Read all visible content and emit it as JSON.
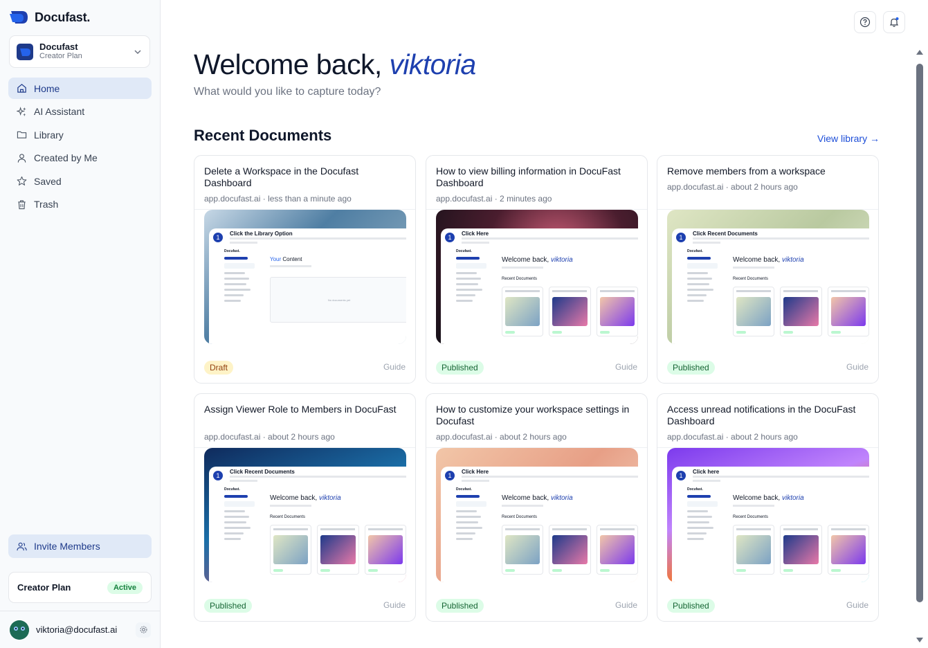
{
  "app": {
    "logo_text": "Docufast.",
    "brand_color": "#1e40af"
  },
  "workspace": {
    "name": "Docufast",
    "plan": "Creator Plan"
  },
  "nav": [
    {
      "label": "Home",
      "icon": "home-icon",
      "active": true
    },
    {
      "label": "AI Assistant",
      "icon": "sparkle-icon",
      "active": false
    },
    {
      "label": "Library",
      "icon": "folder-icon",
      "active": false
    },
    {
      "label": "Created by Me",
      "icon": "user-icon",
      "active": false
    },
    {
      "label": "Saved",
      "icon": "star-icon",
      "active": false
    },
    {
      "label": "Trash",
      "icon": "trash-icon",
      "active": false
    }
  ],
  "invite": {
    "label": "Invite Members"
  },
  "plan_card": {
    "name": "Creator Plan",
    "status": "Active"
  },
  "user": {
    "email": "viktoria@docufast.ai"
  },
  "main": {
    "welcome_prefix": "Welcome back,",
    "username": "viktoria",
    "subtitle": "What would you like to capture today?",
    "section_title": "Recent Documents",
    "view_library": "View library →"
  },
  "documents": [
    {
      "title": "Delete a Workspace in the Docufast Dashboard",
      "meta": "app.docufast.ai · less than a minute ago",
      "status": "Draft",
      "type": "Guide",
      "step_title": "Click the Library Option",
      "thumb": "library"
    },
    {
      "title": "How to view billing information in DocuFast Dashboard",
      "meta": "app.docufast.ai · 2 minutes ago",
      "status": "Published",
      "type": "Guide",
      "step_title": "Click Here",
      "thumb": "dark"
    },
    {
      "title": "Remove members from a workspace",
      "meta": "app.docufast.ai · about 2 hours ago",
      "status": "Published",
      "type": "Guide",
      "step_title": "Click Recent Documents",
      "thumb": "green"
    },
    {
      "title": "Assign Viewer Role to Members in DocuFast",
      "meta": "app.docufast.ai · about 2 hours ago",
      "status": "Published",
      "type": "Guide",
      "step_title": "Click Recent Documents",
      "thumb": "navy"
    },
    {
      "title": "How to customize your workspace settings in Docufast",
      "meta": "app.docufast.ai · about 2 hours ago",
      "status": "Published",
      "type": "Guide",
      "step_title": "Click Here",
      "thumb": "peach"
    },
    {
      "title": "Access unread notifications in the DocuFast Dashboard",
      "meta": "app.docufast.ai · about 2 hours ago",
      "status": "Published",
      "type": "Guide",
      "step_title": "Click here",
      "thumb": "purple"
    }
  ],
  "thumb_content": {
    "logo": "Docufast.",
    "welcome": "Welcome back,",
    "username": "viktoria",
    "recent": "Recent Documents",
    "your_content": "Your Content",
    "your_word": "Your",
    "content_word": "Content",
    "no_docs": "No documents yet"
  }
}
